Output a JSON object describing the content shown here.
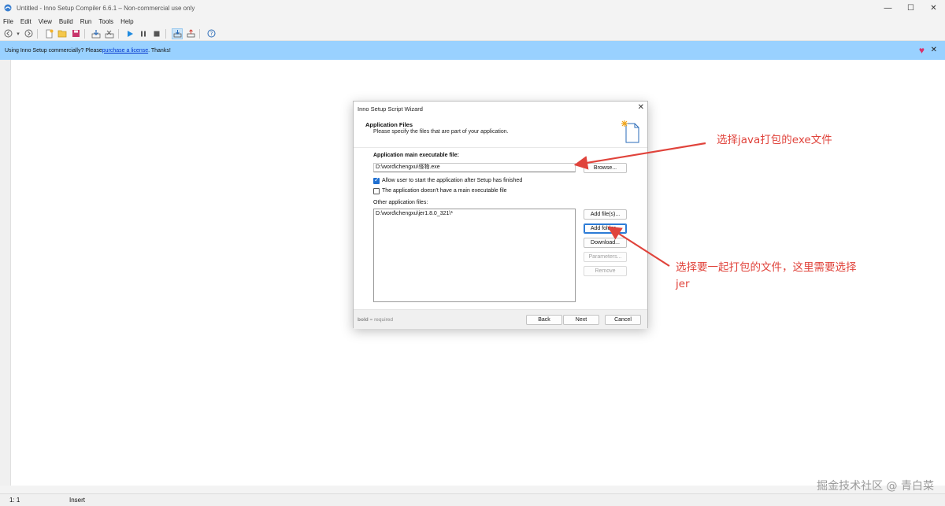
{
  "window": {
    "title": "Untitled - Inno Setup Compiler 6.6.1 – Non-commercial use only",
    "minimize": "—",
    "maximize": "☐",
    "close": "✕"
  },
  "menu": [
    "File",
    "Edit",
    "View",
    "Build",
    "Run",
    "Tools",
    "Help"
  ],
  "toolbar": {
    "icons": [
      "back-icon",
      "forward-icon",
      "new-icon",
      "open-icon",
      "save-icon",
      "compile-icon",
      "compile-stop-icon",
      "run-icon",
      "pause-icon",
      "stop-icon",
      "target-setup-icon",
      "target-uninstall-icon",
      "help-icon"
    ]
  },
  "infobar": {
    "text_before": "Using Inno Setup commercially? Please ",
    "link": "purchase a license",
    "text_after": ". Thanks!",
    "heart": "♥",
    "close": "✕"
  },
  "dialog": {
    "title": "Inno Setup Script Wizard",
    "close": "✕",
    "heading": "Application Files",
    "subheading": "Please specify the files that are part of your application.",
    "main_exe_label": "Application main executable file:",
    "main_exe_value": "D:\\word\\chengxu\\怪物.exe",
    "browse": "Browse...",
    "allow_start_label": "Allow user to start the application after Setup has finished",
    "allow_start_checked": true,
    "no_main_exe_label": "The application doesn't have a main executable file",
    "no_main_exe_checked": false,
    "other_files_label": "Other application files:",
    "other_files": [
      "D:\\word\\chengxu\\jer1.8.0_321\\*"
    ],
    "add_files": "Add file(s)...",
    "add_folder": "Add folder...",
    "download": "Download...",
    "parameters": "Parameters...",
    "remove": "Remove",
    "footer_bold": "bold",
    "footer_text": " = required",
    "back": "Back",
    "next": "Next",
    "cancel": "Cancel"
  },
  "annotations": {
    "exe_note": "选择java打包的exe文件",
    "folder_note_line1": "选择要一起打包的文件，这里需要选择",
    "folder_note_line2": "jer"
  },
  "status": {
    "position": "1:  1",
    "mode": "Insert"
  },
  "watermark": "掘金技术社区 @ 青白菜",
  "colors": {
    "infobar": "#99d1ff",
    "annotation": "#e0433b",
    "accent": "#1f6fd0"
  }
}
